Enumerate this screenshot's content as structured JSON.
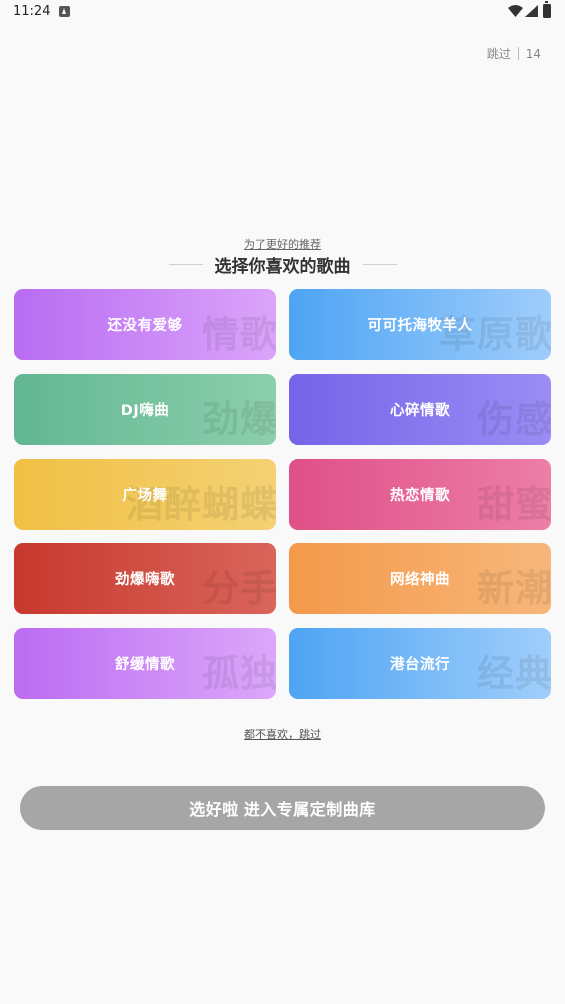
{
  "status_bar": {
    "time": "11:24",
    "icons": [
      "android-a-icon",
      "wifi-icon",
      "signal-icon",
      "battery-icon"
    ]
  },
  "skip_timer": {
    "skip_label": "跳过",
    "countdown": "14"
  },
  "header": {
    "subtitle": "为了更好的推荐",
    "title": "选择你喜欢的歌曲"
  },
  "genres": [
    {
      "label": "还没有爱够",
      "watermark": "情歌",
      "from": "#b86cf2",
      "to": "#dba4fa"
    },
    {
      "label": "可可托海牧羊人",
      "watermark": "草原歌",
      "from": "#4ea4f4",
      "to": "#9fcdfb"
    },
    {
      "label": "DJ嗨曲",
      "watermark": "劲爆",
      "from": "#62b692",
      "to": "#8ccfad"
    },
    {
      "label": "心碎情歌",
      "watermark": "伤感",
      "from": "#7564e9",
      "to": "#9a8df4"
    },
    {
      "label": "广场舞",
      "watermark": "酒醉蝴蝶",
      "from": "#f0c043",
      "to": "#f4d174"
    },
    {
      "label": "热恋情歌",
      "watermark": "甜蜜",
      "from": "#df5087",
      "to": "#ec7ea7"
    },
    {
      "label": "劲爆嗨歌",
      "watermark": "分手",
      "from": "#c8382e",
      "to": "#d9655b"
    },
    {
      "label": "网络神曲",
      "watermark": "新潮",
      "from": "#f4994a",
      "to": "#f7b77a"
    },
    {
      "label": "舒缓情歌",
      "watermark": "孤独",
      "from": "#bb6cf2",
      "to": "#dca7fa"
    },
    {
      "label": "港台流行",
      "watermark": "经典",
      "from": "#4ea4f4",
      "to": "#a0cefb"
    }
  ],
  "skip_all": "都不喜欢，跳过",
  "confirm_button": "选好啦 进入专属定制曲库",
  "colors": {
    "background": "#f9f9f9",
    "button_disabled": "#a6a6a6"
  }
}
